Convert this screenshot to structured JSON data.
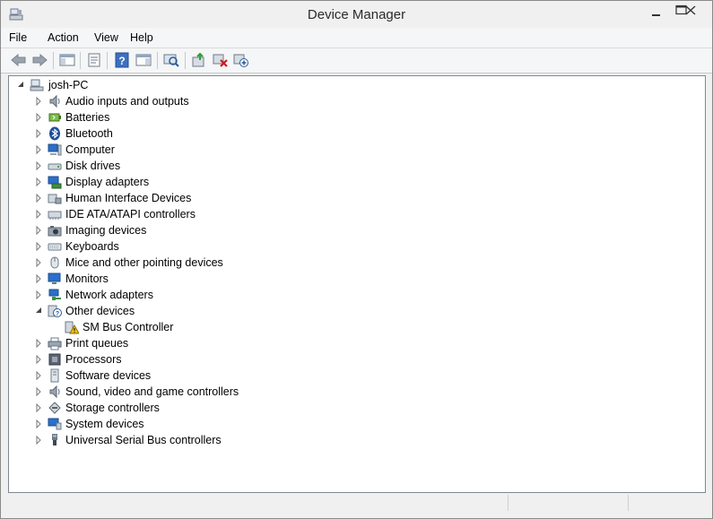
{
  "window": {
    "title": "Device Manager"
  },
  "menu": [
    "File",
    "Action",
    "View",
    "Help"
  ],
  "tree": {
    "root": "josh-PC",
    "items": [
      {
        "label": "Audio inputs and outputs",
        "icon": "speaker-icon"
      },
      {
        "label": "Batteries",
        "icon": "battery-icon"
      },
      {
        "label": "Bluetooth",
        "icon": "bluetooth-icon"
      },
      {
        "label": "Computer",
        "icon": "computer-icon"
      },
      {
        "label": "Disk drives",
        "icon": "disk-drive-icon"
      },
      {
        "label": "Display adapters",
        "icon": "display-adapter-icon"
      },
      {
        "label": "Human Interface Devices",
        "icon": "hid-icon"
      },
      {
        "label": "IDE ATA/ATAPI controllers",
        "icon": "ide-controller-icon"
      },
      {
        "label": "Imaging devices",
        "icon": "camera-icon"
      },
      {
        "label": "Keyboards",
        "icon": "keyboard-icon"
      },
      {
        "label": "Mice and other pointing devices",
        "icon": "mouse-icon"
      },
      {
        "label": "Monitors",
        "icon": "monitor-icon"
      },
      {
        "label": "Network adapters",
        "icon": "network-adapter-icon"
      },
      {
        "label": "Other devices",
        "icon": "unknown-device-icon",
        "expanded": true
      },
      {
        "label": "SM Bus Controller",
        "icon": "warning-device-icon",
        "child": true
      },
      {
        "label": "Print queues",
        "icon": "printer-icon"
      },
      {
        "label": "Processors",
        "icon": "processor-icon"
      },
      {
        "label": "Software devices",
        "icon": "software-device-icon"
      },
      {
        "label": "Sound, video and game controllers",
        "icon": "speaker-icon"
      },
      {
        "label": "Storage controllers",
        "icon": "storage-controller-icon"
      },
      {
        "label": "System devices",
        "icon": "system-device-icon"
      },
      {
        "label": "Universal Serial Bus controllers",
        "icon": "usb-icon"
      }
    ]
  }
}
